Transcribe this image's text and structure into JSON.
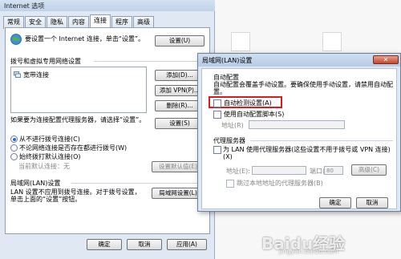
{
  "io_window": {
    "title": "Internet 选项",
    "tabs": [
      "常规",
      "安全",
      "隐私",
      "内容",
      "连接",
      "程序",
      "高级"
    ],
    "active_tab": 4,
    "setup_text": "要设置一个 Internet 连接，单击“设置”。",
    "setup_button": "设置(U)",
    "dialup_title": "拨号和虚拟专用网络设置",
    "connections": [
      "宽带连接"
    ],
    "add_button": "添加(D)...",
    "add_vpn_button": "添加 VPN(P)...",
    "remove_button": "删除(R)...",
    "proxy_note": "如果要为连接配置代理服务器，请选择“设置”。",
    "settings_button": "设置(S)",
    "radio_options": [
      "从不进行拨号连接(C)",
      "不论网络连接是否存在都进行拨号(W)",
      "始终拨打默认连接(O)"
    ],
    "radio_selected": 0,
    "current_default_label": "当前默认连接：",
    "current_default_value": "无",
    "set_default_button": "设置默认值(E)",
    "lan_section_title": "局域网(LAN)设置",
    "lan_note": "LAN 设置不应用到拨号连接。对于拨号设置，单击上面的“设置”按钮。",
    "lan_settings_button": "局域网设置(L)",
    "ok_button": "确定",
    "cancel_button": "取消",
    "apply_button": "应用(A)"
  },
  "lan_dialog": {
    "title": "局域网(LAN)设置",
    "auto_config_title": "自动配置",
    "auto_config_note": "自动配置会覆盖手动设置。要确保使用手动设置，请禁用自动配置。",
    "auto_detect_label": "自动检测设置(A)",
    "use_script_label": "使用自动配置脚本(S)",
    "address_label": "地址(R)",
    "proxy_title": "代理服务器",
    "use_proxy_label": "为 LAN 使用代理服务器(这些设置不用于拨号或 VPN 连接)(X)",
    "proxy_address_label": "地址(E):",
    "port_label": "端口(T):",
    "port_value": "80",
    "advanced_button": "高级(C)",
    "bypass_label": "跳过本地地址的代理服务器(B)",
    "ok_button": "确定",
    "cancel_button": "取消",
    "close_glyph": "✕"
  },
  "watermark": {
    "brand": "Baidu经验",
    "url": "jingyan.baidu.com"
  },
  "colors": {
    "highlight_box": "#e0191e",
    "title_bar": "#bfd2ea"
  }
}
